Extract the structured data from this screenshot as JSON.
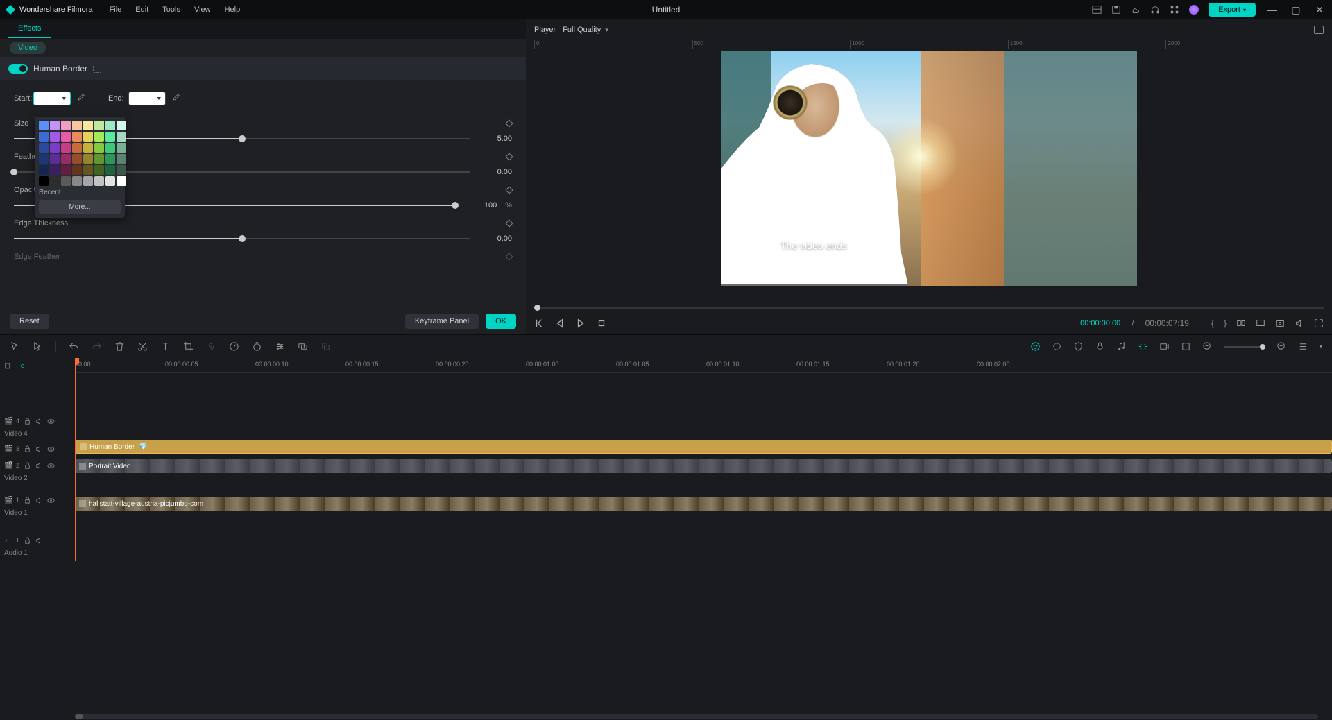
{
  "app": {
    "name": "Wondershare Filmora",
    "doc_title": "Untitled"
  },
  "menu": [
    "File",
    "Edit",
    "Tools",
    "View",
    "Help"
  ],
  "export_label": "Export",
  "effects_tab": "Effects",
  "video_tab": "Video",
  "effect": {
    "name": "Human Border",
    "start_label": "Start:",
    "end_label": "End:",
    "params": [
      {
        "label": "Size",
        "value": "5.00",
        "pct": 50
      },
      {
        "label": "Feather",
        "value": "0.00",
        "pct": 0
      },
      {
        "label": "Opacity",
        "value": "100",
        "suffix": "%",
        "pct": 100
      },
      {
        "label": "Edge Thickness",
        "value": "0.00",
        "pct": 50
      },
      {
        "label": "Edge Feather",
        "value": "",
        "pct": 0
      }
    ],
    "reset": "Reset",
    "keyframe_panel": "Keyframe Panel",
    "ok": "OK"
  },
  "color_picker": {
    "colors": [
      [
        "#5b8ff9",
        "#c393f7",
        "#f29dc4",
        "#f7c59f",
        "#f7e79f",
        "#c4e79f",
        "#9fe7c4",
        "#d4f7e7"
      ],
      [
        "#3d6bd6",
        "#9f5be8",
        "#e85ba6",
        "#e88a5b",
        "#e8d15b",
        "#a6e85b",
        "#5be89f",
        "#a6d6c4"
      ],
      [
        "#2b4a9f",
        "#7a3dc9",
        "#c93d86",
        "#c96a3d",
        "#c9b03d",
        "#86c93d",
        "#3dc97a",
        "#7ab096"
      ],
      [
        "#1f3675",
        "#5b2d96",
        "#962d64",
        "#964f2d",
        "#96832d",
        "#64962d",
        "#2d965b",
        "#5b8370"
      ],
      [
        "#15254f",
        "#3d1e64",
        "#641e43",
        "#64351e",
        "#64571e",
        "#43641e",
        "#1e643d",
        "#3d574b"
      ],
      [
        "#000000",
        "#2d2d2d",
        "#5b5b5b",
        "#888888",
        "#a6a6a6",
        "#c4c4c4",
        "#e2e2e2",
        "#ffffff"
      ]
    ],
    "recent_label": "Recent",
    "more_label": "More..."
  },
  "player": {
    "tab": "Player",
    "quality": "Full Quality",
    "overlay_text": "The video ends",
    "time_current": "00:00:00:00",
    "time_total": "00:00:07:19",
    "ruler": [
      "0",
      "500",
      "1000",
      "1500",
      "2000"
    ]
  },
  "timeline": {
    "ruler": [
      "00:00",
      "00:00:00:05",
      "00:00:00:10",
      "00:00:00:15",
      "00:00:00:20",
      "00:00:01:00",
      "00:00:01:05",
      "00:00:01:10",
      "00:00:01:15",
      "00:00:01:20",
      "00:00:02:00"
    ],
    "tracks": [
      {
        "id": "4",
        "type": "video",
        "label": "Video 4"
      },
      {
        "id": "3",
        "type": "video",
        "label": ""
      },
      {
        "id": "2",
        "type": "video",
        "label": "Video 2"
      },
      {
        "id": "1",
        "type": "video",
        "label": "Video 1"
      },
      {
        "id": "1",
        "type": "audio",
        "label": "Audio 1"
      }
    ],
    "clips": {
      "effect": "Human Border",
      "portrait": "Portrait Video",
      "bg": "hallstatt-village-austria-picjumbo-com"
    }
  }
}
